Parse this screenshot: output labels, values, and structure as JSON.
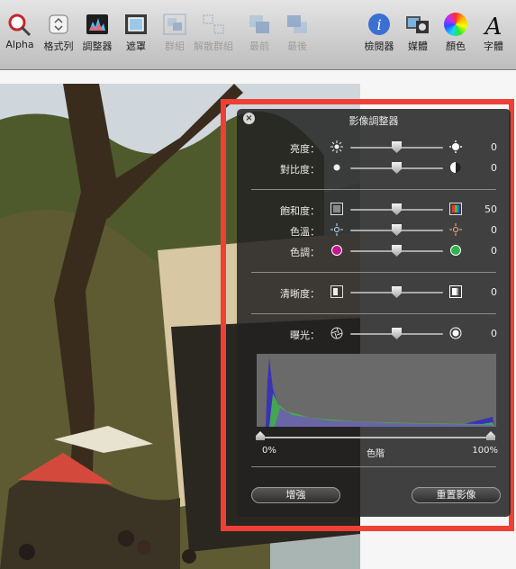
{
  "toolbar": {
    "items": [
      {
        "label": "Alpha",
        "icon": "magic-wand-icon"
      },
      {
        "label": "格式列",
        "icon": "format-bar-icon"
      },
      {
        "label": "調整器",
        "icon": "adjust-icon"
      },
      {
        "label": "遮罩",
        "icon": "mask-icon"
      },
      {
        "label": "群組",
        "icon": "group-icon",
        "disabled": true
      },
      {
        "label": "解散群組",
        "icon": "ungroup-icon",
        "disabled": true
      },
      {
        "label": "最前",
        "icon": "bring-front-icon",
        "disabled": true
      },
      {
        "label": "最後",
        "icon": "send-back-icon",
        "disabled": true
      },
      {
        "label": "檢閱器",
        "icon": "inspector-icon"
      },
      {
        "label": "媒體",
        "icon": "media-icon"
      },
      {
        "label": "顏色",
        "icon": "color-wheel-icon"
      },
      {
        "label": "字體",
        "icon": "fonts-icon"
      }
    ]
  },
  "panel": {
    "title": "影像調整器",
    "rows": [
      {
        "label": "亮度：",
        "value": "0",
        "slider": 0.5
      },
      {
        "label": "對比度：",
        "value": "0",
        "slider": 0.5
      },
      {
        "label": "飽和度：",
        "value": "50",
        "slider": 0.5
      },
      {
        "label": "色溫：",
        "value": "0",
        "slider": 0.5
      },
      {
        "label": "色調：",
        "value": "0",
        "slider": 0.5
      },
      {
        "label": "清晰度：",
        "value": "0",
        "slider": 0.5
      },
      {
        "label": "曝光：",
        "value": "0",
        "slider": 0.5
      }
    ],
    "levels": {
      "min_label": "0%",
      "center_label": "色階",
      "max_label": "100%",
      "min": 0,
      "max": 1
    },
    "enhance_button": "增強",
    "reset_button": "重置影像"
  },
  "colors": {
    "highlight": "#ee4035",
    "panel_bg": "#222222"
  }
}
